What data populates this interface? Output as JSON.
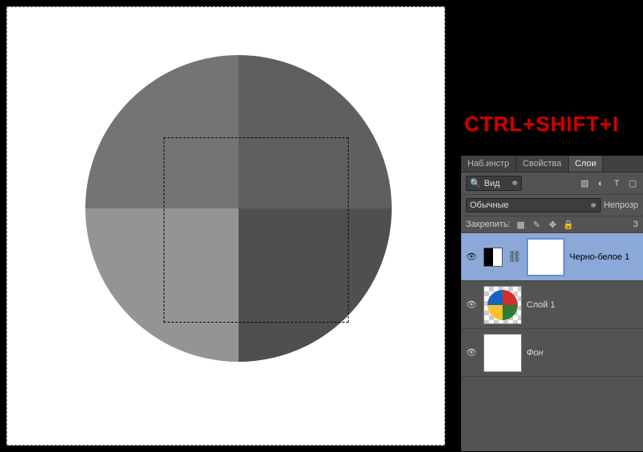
{
  "annotation": "CTRL+SHIFT+I",
  "panel": {
    "tabs": [
      "Наб.инстр",
      "Свойства",
      "Слои"
    ],
    "active_tab": 2,
    "filter_label": "Вид",
    "blend_mode": "Обычные",
    "opacity_label": "Непрозр",
    "lock_label": "Закрепить:",
    "fill_label": "З"
  },
  "layers": [
    {
      "name": "Черно-белое 1",
      "type": "adjustment",
      "selected": true,
      "visible": true
    },
    {
      "name": "Слой 1",
      "type": "image",
      "selected": false,
      "visible": true
    },
    {
      "name": "Фон",
      "type": "background",
      "selected": false,
      "visible": true
    }
  ]
}
